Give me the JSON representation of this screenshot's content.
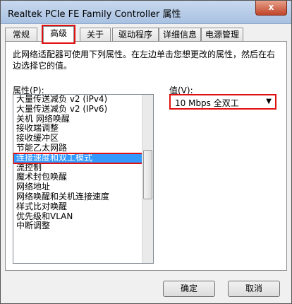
{
  "window": {
    "title": "Realtek PCIe FE Family Controller 属性",
    "close_label": "x"
  },
  "tabs": [
    {
      "label": "常规"
    },
    {
      "label": "高级",
      "active": true
    },
    {
      "label": "关于"
    },
    {
      "label": "驱动程序"
    },
    {
      "label": "详细信息"
    },
    {
      "label": "电源管理"
    }
  ],
  "advanced": {
    "description": "此网络适配器可使用下列属性。在左边单击您想更改的属性，然后在右边选择它的值。",
    "property_label": "属性(P):",
    "value_label": "值(V):",
    "properties": [
      "大量传送减负 v2 (IPv4)",
      "大量传送减负 v2 (IPv6)",
      "关机 网络唤醒",
      "接收端调整",
      "接收缓冲区",
      "节能乙太网路",
      "连接速度和双工模式",
      "流控制",
      "魔术封包唤醒",
      "网络地址",
      "网络唤醒和关机连接速度",
      "样式比对唤醒",
      "优先级和VLAN",
      "中断调整"
    ],
    "selected_index": 6,
    "selected_value": "10 Mbps 全双工"
  },
  "buttons": {
    "ok": "确定",
    "cancel": "取消"
  }
}
